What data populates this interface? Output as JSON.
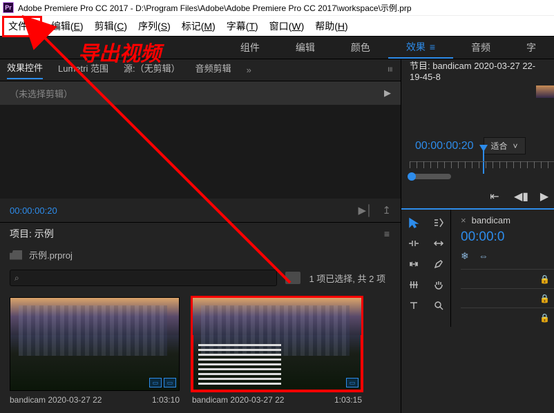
{
  "titlebar": {
    "app_icon_text": "Pr",
    "title": "Adobe Premiere Pro CC 2017 - D:\\Program Files\\Adobe\\Adobe Premiere Pro CC 2017\\workspace\\示例.prp"
  },
  "menubar": {
    "items": [
      {
        "label": "文件(",
        "accel": "F",
        "tail": ")"
      },
      {
        "label": "编辑(",
        "accel": "E",
        "tail": ")"
      },
      {
        "label": "剪辑(",
        "accel": "C",
        "tail": ")"
      },
      {
        "label": "序列(",
        "accel": "S",
        "tail": ")"
      },
      {
        "label": "标记(",
        "accel": "M",
        "tail": ")"
      },
      {
        "label": "字幕(",
        "accel": "T",
        "tail": ")"
      },
      {
        "label": "窗口(",
        "accel": "W",
        "tail": ")"
      },
      {
        "label": "帮助(",
        "accel": "H",
        "tail": ")"
      }
    ]
  },
  "annotation": {
    "text": "导出视频"
  },
  "workspace_tabs": {
    "items": [
      "组件",
      "编辑",
      "颜色",
      "效果",
      "音频",
      "字"
    ],
    "selected_index": 3,
    "chevron": "≡"
  },
  "effect_controls": {
    "tabs": [
      "效果控件",
      "Lumetri 范围",
      "源:（无剪辑）",
      "音频剪辑"
    ],
    "active_index": 0,
    "extra": "≡",
    "no_clip_label": "（未选择剪辑）",
    "timecode": "00:00:00:20",
    "tri": "▶",
    "btn1": "▶│",
    "btn2": "↥"
  },
  "project_panel": {
    "title": "项目: 示例",
    "grip": "≡",
    "file_label": "示例.prproj",
    "search_icon": "⌕",
    "selection_info": "1 项已选择, 共 2 项",
    "thumbs": [
      {
        "name": "bandicam 2020-03-27 22",
        "duration": "1:03:10",
        "selected": false,
        "badge": [
          "▭",
          "▭"
        ]
      },
      {
        "name": "bandicam 2020-03-27 22",
        "duration": "1:03:15",
        "selected": true,
        "badge": [
          "▭"
        ]
      }
    ]
  },
  "program_monitor": {
    "title": "节目: bandicam 2020-03-27 22-19-45-8",
    "timecode": "00:00:00:20",
    "fit_label": "适合",
    "fit_chevron": "˅",
    "transport": {
      "mark_in": "⇤",
      "step_back": "◀▮",
      "play": "▶"
    }
  },
  "timeline": {
    "tab_close": "×",
    "tab_label": "bandicam",
    "timecode": "00:00:0",
    "icons": [
      "❄",
      "⇔"
    ],
    "lock_icon": "🔒"
  },
  "tools": {
    "row1": [
      "sel",
      "track-sel"
    ],
    "names": {
      "sel": "selection-tool",
      "track-sel": "track-select-tool",
      "ripple": "ripple-edit-tool",
      "rate": "rate-stretch-tool",
      "slip": "slip-tool",
      "pen": "pen-tool",
      "razor": "razor-tool",
      "hand": "hand-tool",
      "type": "type-tool",
      "zoom": "zoom-tool"
    }
  }
}
